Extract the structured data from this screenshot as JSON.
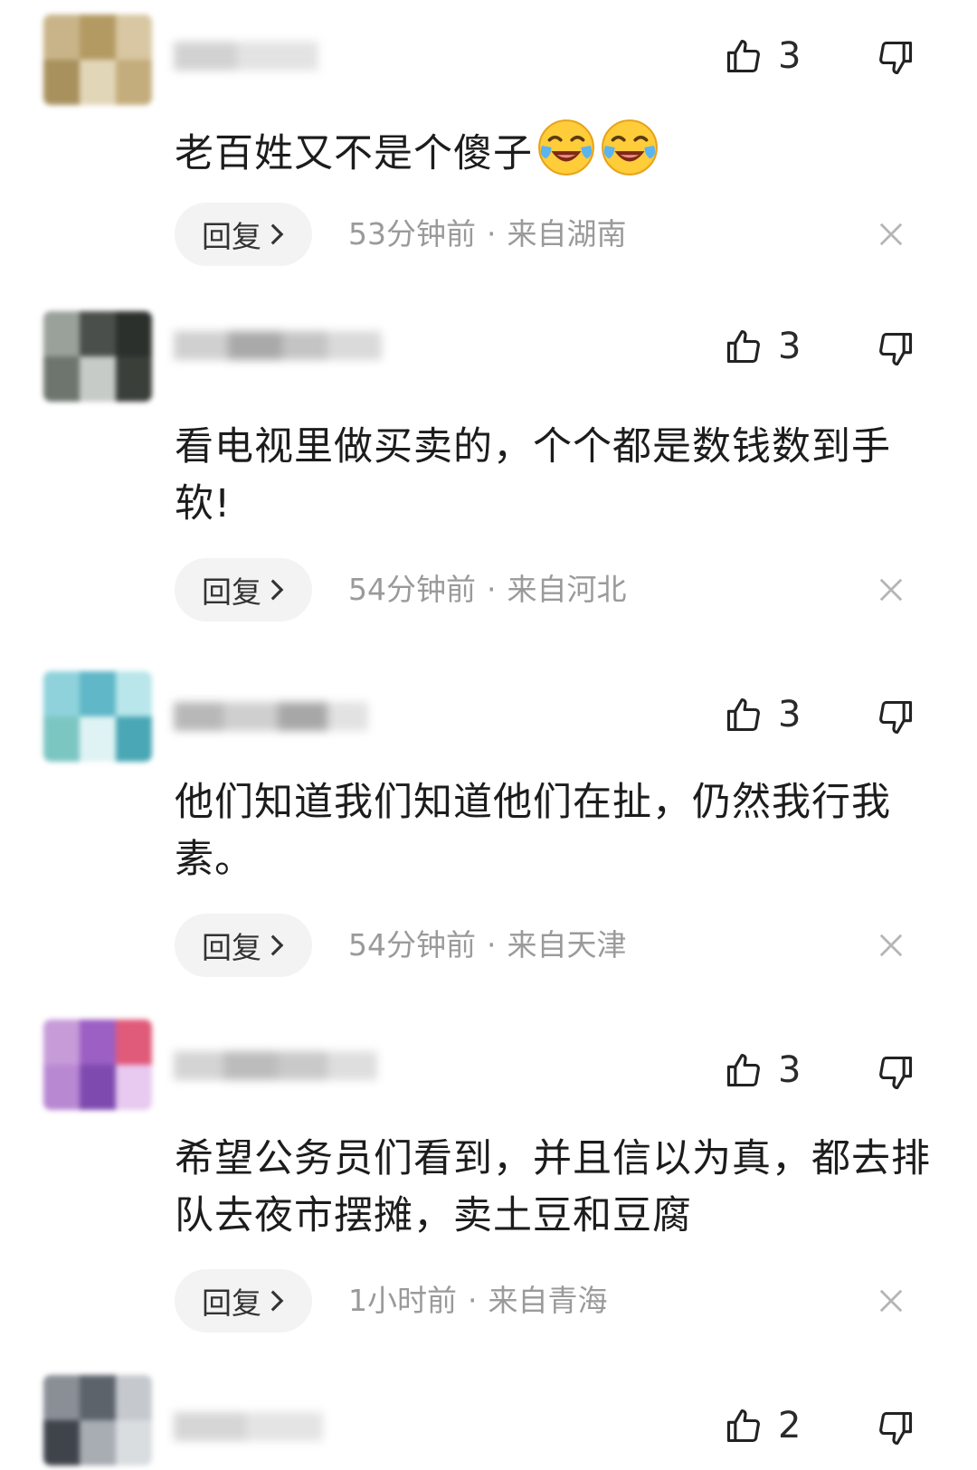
{
  "comments": [
    {
      "likes": "3",
      "text": "老百姓又不是个傻子",
      "emoji_count": 2,
      "reply_label": "回复",
      "time": "53分钟前",
      "location": "来自湖南",
      "avatar_colors": [
        "#c9b489",
        "#b39a62",
        "#d8c7a2",
        "#a8915d",
        "#e2d6b9",
        "#c4ad7d"
      ]
    },
    {
      "likes": "3",
      "text": "看电视里做买卖的，个个都是数钱数到手软!",
      "emoji_count": 0,
      "reply_label": "回复",
      "time": "54分钟前",
      "location": "来自河北",
      "avatar_colors": [
        "#9aa09a",
        "#4b4f4b",
        "#2c302c",
        "#6e756e",
        "#c7cbc7",
        "#3a3f3a"
      ]
    },
    {
      "likes": "3",
      "text": "他们知道我们知道他们在扯，仍然我行我素。",
      "emoji_count": 0,
      "reply_label": "回复",
      "time": "54分钟前",
      "location": "来自天津",
      "avatar_colors": [
        "#8fd2dc",
        "#5fb7c7",
        "#b9e6ea",
        "#7cc6c2",
        "#dff3f4",
        "#4aa7b5"
      ]
    },
    {
      "likes": "3",
      "text": "希望公务员们看到，并且信以为真，都去排队去夜市摆摊，卖土豆和豆腐",
      "emoji_count": 0,
      "reply_label": "回复",
      "time": "1小时前",
      "location": "来自青海",
      "avatar_colors": [
        "#c79bd8",
        "#9c5fc4",
        "#e05a7a",
        "#b988d3",
        "#7e4ab0",
        "#e8c9ef"
      ]
    },
    {
      "likes": "2",
      "avatar_colors": [
        "#8a8f96",
        "#5d636b",
        "#c5c9ce",
        "#3f444b",
        "#a8adb3",
        "#dadde0"
      ]
    }
  ]
}
